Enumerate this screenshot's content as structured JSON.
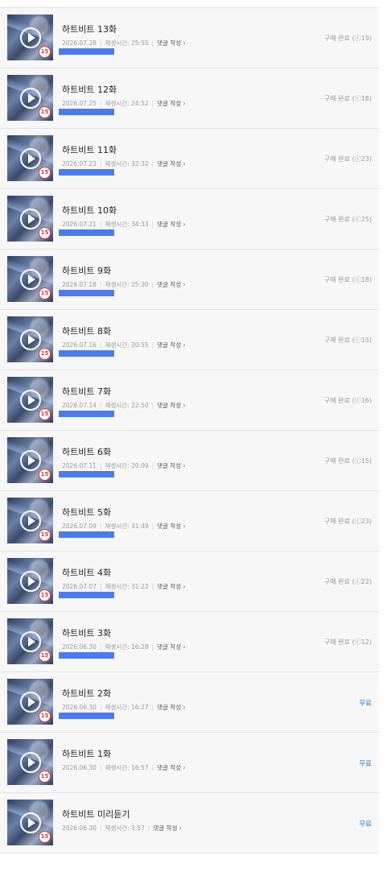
{
  "episodes": [
    {
      "title": "하트비트 13화",
      "date": "2026.07.28",
      "duration_label": "재생시간: 25:55",
      "comment_label": "댓글 작성 ›",
      "status": "구매 완료 (ⓒ19)",
      "status_type": "purchased",
      "progress": 1.0
    },
    {
      "title": "하트비트 12화",
      "date": "2026.07.25",
      "duration_label": "재생시간: 24:52",
      "comment_label": "댓글 작성 ›",
      "status": "구매 완료 (ⓒ18)",
      "status_type": "purchased",
      "progress": 1.0
    },
    {
      "title": "하트비트 11화",
      "date": "2026.07.23",
      "duration_label": "재생시간: 32:32",
      "comment_label": "댓글 작성 ›",
      "status": "구매 완료 (ⓒ23)",
      "status_type": "purchased",
      "progress": 1.0
    },
    {
      "title": "하트비트 10화",
      "date": "2026.07.21",
      "duration_label": "재생시간: 34:33",
      "comment_label": "댓글 작성 ›",
      "status": "구매 완료 (ⓒ25)",
      "status_type": "purchased",
      "progress": 1.0
    },
    {
      "title": "하트비트 9화",
      "date": "2026.07.18",
      "duration_label": "재생시간: 25:30",
      "comment_label": "댓글 작성 ›",
      "status": "구매 완료 (ⓒ18)",
      "status_type": "purchased",
      "progress": 1.0
    },
    {
      "title": "하트비트 8화",
      "date": "2026.07.16",
      "duration_label": "재생시간: 20:55",
      "comment_label": "댓글 작성 ›",
      "status": "구매 완료 (ⓒ15)",
      "status_type": "purchased",
      "progress": 1.0
    },
    {
      "title": "하트비트 7화",
      "date": "2026.07.14",
      "duration_label": "재생시간: 22:50",
      "comment_label": "댓글 작성 ›",
      "status": "구매 완료 (ⓒ16)",
      "status_type": "purchased",
      "progress": 1.0
    },
    {
      "title": "하트비트 6화",
      "date": "2026.07.11",
      "duration_label": "재생시간: 20:09",
      "comment_label": "댓글 작성 ›",
      "status": "구매 완료 (ⓒ15)",
      "status_type": "purchased",
      "progress": 1.0
    },
    {
      "title": "하트비트 5화",
      "date": "2026.07.09",
      "duration_label": "재생시간: 31:49",
      "comment_label": "댓글 작성 ›",
      "status": "구매 완료 (ⓒ23)",
      "status_type": "purchased",
      "progress": 1.0
    },
    {
      "title": "하트비트 4화",
      "date": "2026.07.07",
      "duration_label": "재생시간: 31:22",
      "comment_label": "댓글 작성 ›",
      "status": "구매 완료 (ⓒ22)",
      "status_type": "purchased",
      "progress": 1.0
    },
    {
      "title": "하트비트 3화",
      "date": "2026.06.30",
      "duration_label": "재생시간: 16:28",
      "comment_label": "댓글 작성 ›",
      "status": "구매 완료 (ⓒ12)",
      "status_type": "purchased",
      "progress": 1.0
    },
    {
      "title": "하트비트 2화",
      "date": "2026.06.30",
      "duration_label": "재생시간: 16:27",
      "comment_label": "댓글 작성 ›",
      "status": "무료",
      "status_type": "free",
      "progress": 1.0
    },
    {
      "title": "하트비트 1화",
      "date": "2026.06.30",
      "duration_label": "재생시간: 16:57",
      "comment_label": "댓글 작성 ›",
      "status": "무료",
      "status_type": "free",
      "progress": 0
    },
    {
      "title": "하트비트 미리듣기",
      "date": "2026.06.30",
      "duration_label": "재생시간: 3:57",
      "comment_label": "댓글 작성 ›",
      "status": "무료",
      "status_type": "free",
      "progress": 0
    }
  ],
  "age_rating": "15",
  "colors": {
    "progress": "#4a7bf0",
    "free_status": "#2a7fd0",
    "purchased_status": "#999999",
    "age_badge": "#d93b3b"
  }
}
